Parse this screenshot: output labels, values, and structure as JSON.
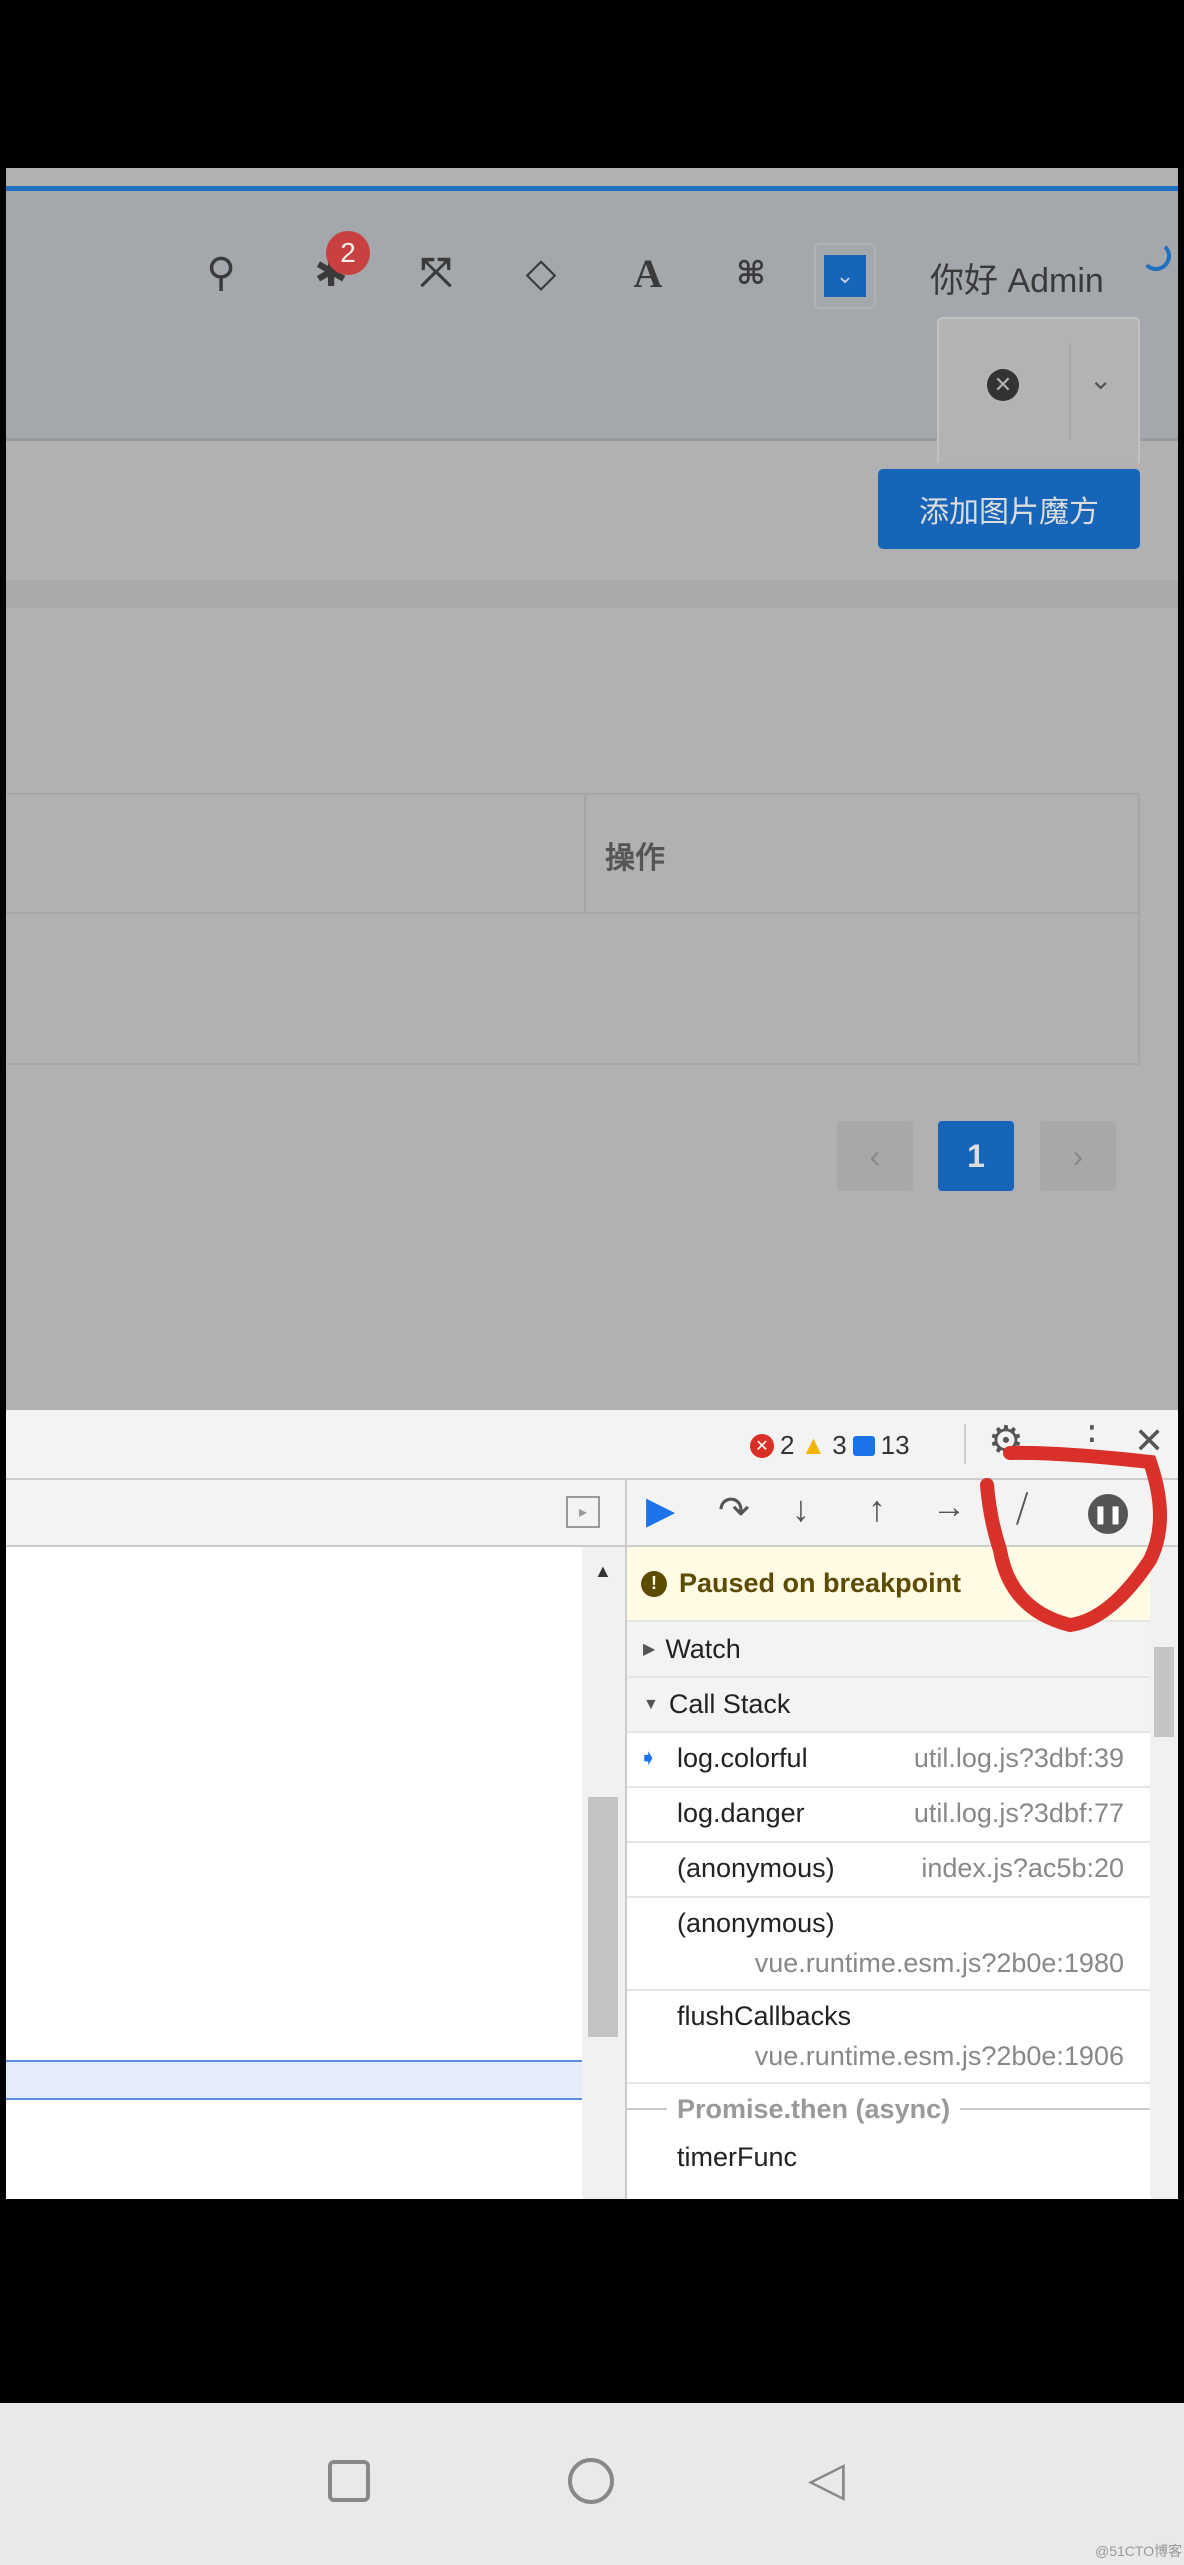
{
  "header": {
    "icons": [
      "search-icon",
      "bug-icon",
      "fullscreen-icon",
      "diamond-icon",
      "font-size-icon",
      "translate-icon",
      "theme-dropdown-icon"
    ],
    "bug_badge": "2",
    "greeting": "你好 Admin"
  },
  "tags": {
    "close_icon": "close-circle-icon",
    "dropdown_icon": "chevron-down-icon"
  },
  "toolbar": {
    "add_button": "添加图片魔方"
  },
  "table": {
    "columns": [
      "操作"
    ]
  },
  "pagination": {
    "prev": "‹",
    "current": "1",
    "next": "›"
  },
  "devtools": {
    "errors": "2",
    "warnings": "3",
    "messages": "13",
    "paused": "Paused on breakpoint",
    "watch": "Watch",
    "call_stack": "Call Stack",
    "frames": [
      {
        "fn": "log.colorful",
        "loc": "util.log.js?3dbf:39"
      },
      {
        "fn": "log.danger",
        "loc": "util.log.js?3dbf:77"
      },
      {
        "fn": "(anonymous)",
        "loc": "index.js?ac5b:20"
      },
      {
        "fn": "(anonymous)",
        "loc": "vue.runtime.esm.js?2b0e:1980"
      },
      {
        "fn": "flushCallbacks",
        "loc": "vue.runtime.esm.js?2b0e:1906"
      }
    ],
    "async_label": "Promise.then (async)",
    "last_frame": "timerFunc",
    "accent": "#1a73e8"
  },
  "annotation_color": "#d9302a",
  "watermark": "@51CTO博客"
}
